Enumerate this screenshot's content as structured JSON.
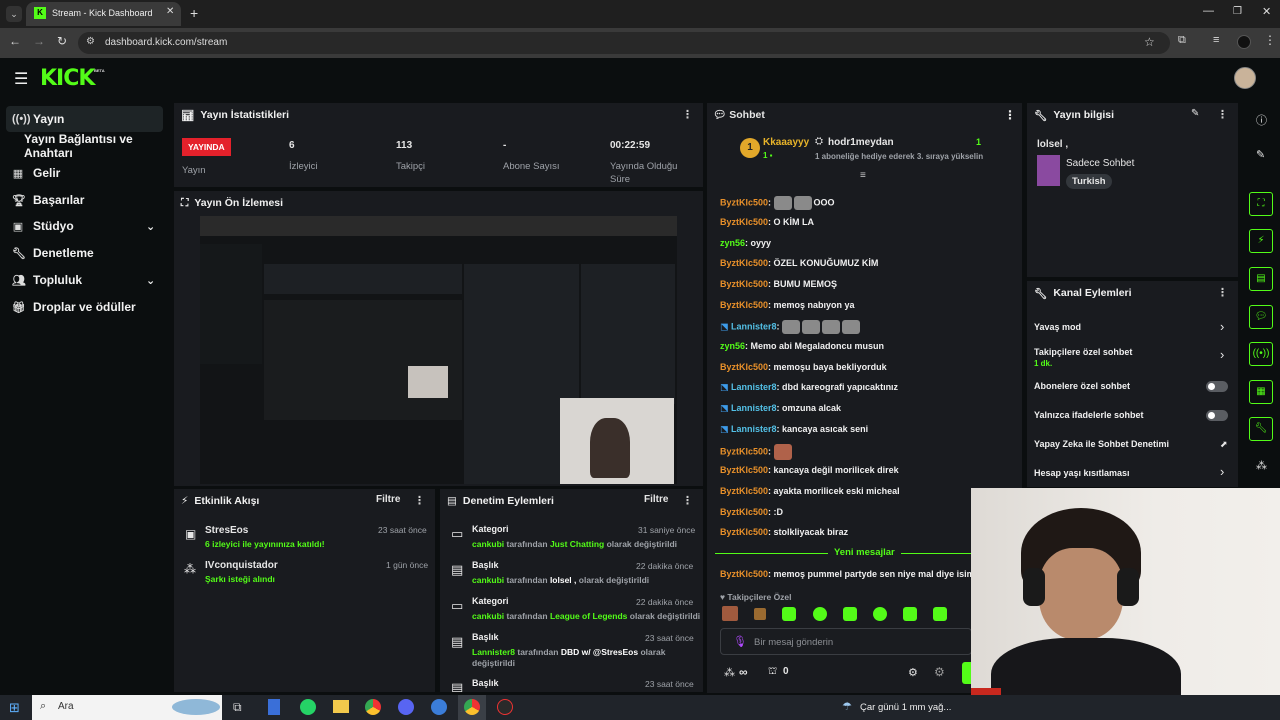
{
  "browser": {
    "tab_title": "Stream - Kick Dashboard",
    "url": "dashboard.kick.com/stream",
    "new_tab": "+"
  },
  "header": {
    "logo": "KICK",
    "beta": "BETA"
  },
  "sidebar": {
    "items": [
      {
        "label": "Yayın",
        "icon": "broadcast-icon"
      },
      {
        "label": "Yayın Bağlantısı ve Anahtarı"
      },
      {
        "label": "Gelir",
        "icon": "chart-icon"
      },
      {
        "label": "Başarılar",
        "icon": "trophy-icon"
      },
      {
        "label": "Stüdyo",
        "icon": "studio-icon"
      },
      {
        "label": "Denetleme",
        "icon": "wrench-icon"
      },
      {
        "label": "Topluluk",
        "icon": "community-icon"
      },
      {
        "label": "Droplar ve ödüller",
        "icon": "gift-icon"
      }
    ]
  },
  "stats": {
    "title": "Yayın İstatistikleri",
    "live_badge": "YAYINDA",
    "live_label": "Yayın",
    "viewers_value": "6",
    "viewers_label": "İzleyici",
    "followers_value": "113",
    "followers_label": "Takipçi",
    "subs_value": "-",
    "subs_label": "Abone Sayısı",
    "uptime_value": "00:22:59",
    "uptime_label_1": "Yayında Olduğu",
    "uptime_label_2": "Süre"
  },
  "preview": {
    "title": "Yayın Ön İzlemesi"
  },
  "activity": {
    "title": "Etkinlik Akışı",
    "filter": "Filtre",
    "items": [
      {
        "user": "StresEos",
        "time": "23 saat önce",
        "detail": "6 izleyici ile yayınınıza katıldı!"
      },
      {
        "user": "IVconquistador",
        "time": "1 gün önce",
        "detail": "Şarkı isteği alındı"
      }
    ]
  },
  "moderation": {
    "title": "Denetim Eylemleri",
    "filter": "Filtre",
    "items": [
      {
        "type": "Kategori",
        "time": "31 saniye önce",
        "user": "cankubi",
        "mid": " tarafından ",
        "value": "Just Chatting",
        "end": " olarak değiştirildi"
      },
      {
        "type": "Başlık",
        "time": "22 dakika önce",
        "user": "cankubi",
        "mid": " tarafından ",
        "value": "lolsel ,",
        "end": " olarak değiştirildi"
      },
      {
        "type": "Kategori",
        "time": "22 dakika önce",
        "user": "cankubi",
        "mid": " tarafından ",
        "value": "League of Legends",
        "end": " olarak değiştirildi"
      },
      {
        "type": "Başlık",
        "time": "23 saat önce",
        "user": "Lannister8",
        "mid": " tarafından ",
        "value": "DBD w/ @StresEos",
        "end": " olarak",
        "end2": "değiştirildi"
      },
      {
        "type": "Başlık",
        "time": "23 saat önce"
      }
    ]
  },
  "chat": {
    "title": "Sohbet",
    "pinned_user1": "Kkaaayyy",
    "pinned_level": "1",
    "pinned_user2": "hodr1meydan",
    "pinned_count": "1",
    "pinned_msg": "1 aboneliğe hediye ederek 3. sıraya yükselin",
    "messages": [
      {
        "user": "ByztKlc500",
        "text": ": ",
        "tail": "OOO"
      },
      {
        "user": "ByztKlc500",
        "text": ": O KİM LA"
      },
      {
        "user": "zyn56",
        "text": ": oyyy"
      },
      {
        "user": "ByztKlc500",
        "text": ": ÖZEL KONUĞUMUZ KİM"
      },
      {
        "user": "ByztKlc500",
        "text": ": BUMU MEMOŞ"
      },
      {
        "user": "ByztKlc500",
        "text": ": memoş nabıyon ya"
      },
      {
        "user": "Lannister8",
        "text": ": "
      },
      {
        "user": "zyn56",
        "text": ": Memo abi Megaladoncu musun"
      },
      {
        "user": "ByztKlc500",
        "text": ": memoşu baya bekliyorduk"
      },
      {
        "user": "Lannister8",
        "text": ": dbd kareografi yapıcaktınız"
      },
      {
        "user": "Lannister8",
        "text": ": omzuna alcak"
      },
      {
        "user": "Lannister8",
        "text": ": kancaya asıcak seni"
      },
      {
        "user": "ByztKlc500",
        "text": ": "
      },
      {
        "user": "ByztKlc500",
        "text": ": kancaya değil morilicek direk"
      },
      {
        "user": "ByztKlc500",
        "text": ": ayakta morilicek eski micheal"
      },
      {
        "user": "ByztKlc500",
        "text": ": :D"
      },
      {
        "user": "ByztKlc500",
        "text": ": stolkliyacak biraz"
      }
    ],
    "new_messages": "Yeni mesajlar",
    "last_msg_user": "ByztKlc500",
    "last_msg_text": ": memoş pummel partyde sen niye mal diye isim i",
    "followers_only": "Takipçilere Özel",
    "input_placeholder": "Bir mesaj gönderin",
    "bottom_inf": "∞",
    "bottom_zero": "0"
  },
  "stream_info": {
    "title": "Yayın bilgisi",
    "stream_title": "lolsel ,",
    "category": "Sadece Sohbet",
    "tag": "Turkish"
  },
  "channel_actions": {
    "title": "Kanal Eylemleri",
    "items": [
      {
        "label": "Yavaş mod",
        "control": "chevron"
      },
      {
        "label": "Takipçilere özel sohbet",
        "sub": "1 dk.",
        "control": "chevron"
      },
      {
        "label": "Abonelere özel sohbet",
        "control": "toggle"
      },
      {
        "label": "Yalnızca ifadelerle sohbet",
        "control": "toggle"
      },
      {
        "label": "Yapay Zeka ile Sohbet Denetimi",
        "control": "external"
      },
      {
        "label": "Hesap yaşı kısıtlaması",
        "control": "chevron"
      }
    ]
  },
  "taskbar": {
    "search": "Ara",
    "weather": "Çar günü 1 mm yağ..."
  },
  "colors": {
    "accent": "#53fc18",
    "live": "#e4212b",
    "username": "#e8902a"
  }
}
